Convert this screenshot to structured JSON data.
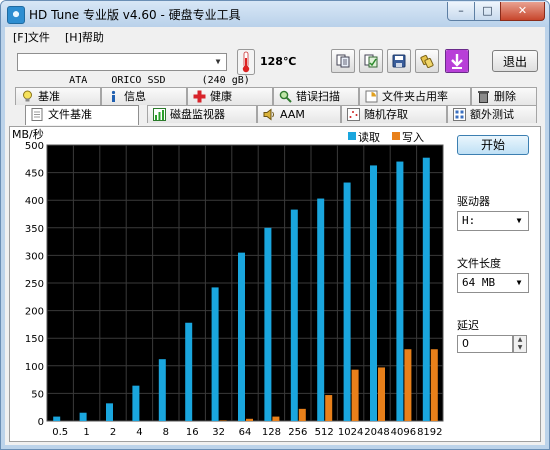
{
  "window": {
    "title": "HD Tune 专业版 v4.60 - 硬盘专业工具",
    "min": "–",
    "max": "□",
    "close": "✕"
  },
  "menu": [
    "[F]文件",
    "[H]帮助"
  ],
  "toolbar": {
    "drive": "ATA    ORICO SSD      (240 gB)",
    "temperature": "128℃",
    "exit_label": "退出",
    "icons": [
      "copy-icon",
      "copy-all-icon",
      "save-icon",
      "options-icon",
      "download-icon"
    ]
  },
  "tabs": {
    "row1": [
      {
        "label": "基准",
        "icon": "lightbulb-icon"
      },
      {
        "label": "信息",
        "icon": "info-icon"
      },
      {
        "label": "健康",
        "icon": "health-cross-icon"
      },
      {
        "label": "错误扫描",
        "icon": "magnifier-icon"
      },
      {
        "label": "文件夹占用率",
        "icon": "folder-usage-icon"
      },
      {
        "label": "删除",
        "icon": "trash-icon"
      }
    ],
    "row2": [
      {
        "label": "文件基准",
        "icon": "file-benchmark-icon",
        "active": true
      },
      {
        "label": "磁盘监视器",
        "icon": "disk-monitor-icon"
      },
      {
        "label": "AAM",
        "icon": "speaker-icon"
      },
      {
        "label": "随机存取",
        "icon": "random-access-icon"
      },
      {
        "label": "额外测试",
        "icon": "extra-tests-icon"
      }
    ]
  },
  "side": {
    "start_label": "开始",
    "drive_label": "驱动器",
    "drive_value": "H:",
    "length_label": "文件长度",
    "length_value": "64 MB",
    "delay_label": "延迟",
    "delay_value": "0"
  },
  "colors": {
    "read": "#1aa6de",
    "write": "#e8801a",
    "plot_bg": "#000000"
  },
  "chart_data": {
    "type": "bar",
    "ylabel": "MB/秒",
    "ylim": [
      0,
      500
    ],
    "yticks": [
      0,
      50,
      100,
      150,
      200,
      250,
      300,
      350,
      400,
      450,
      500
    ],
    "categories": [
      "0.5",
      "1",
      "2",
      "4",
      "8",
      "16",
      "32",
      "64",
      "128",
      "256",
      "512",
      "1024",
      "2048",
      "4096",
      "8192"
    ],
    "series": [
      {
        "name": "读取",
        "values": [
          8,
          15,
          32,
          64,
          112,
          178,
          242,
          305,
          350,
          383,
          403,
          432,
          463,
          470,
          477
        ]
      },
      {
        "name": "写入",
        "values": [
          0,
          0,
          0,
          0,
          0,
          0,
          1,
          4,
          8,
          22,
          47,
          93,
          97,
          130,
          130
        ]
      }
    ],
    "legend": "top-right",
    "grid": true
  }
}
